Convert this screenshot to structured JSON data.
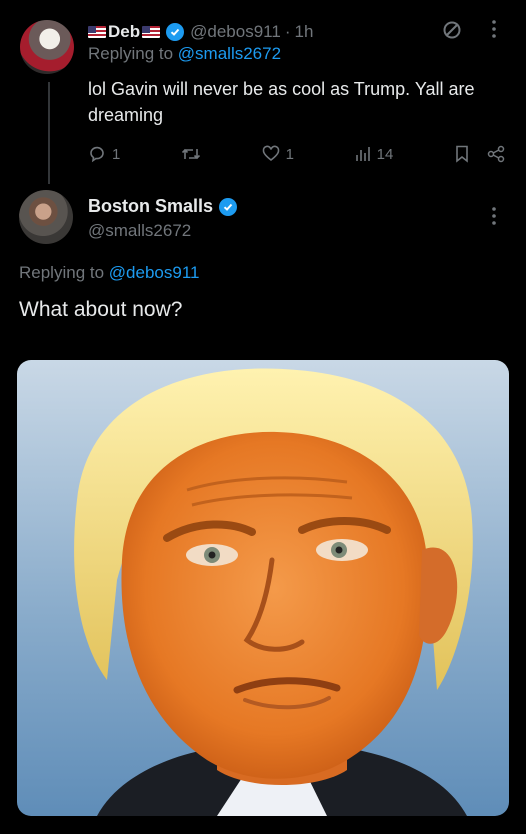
{
  "parent_tweet": {
    "display_name": "Deb",
    "handle": "@debos911",
    "time": "1h",
    "replying_prefix": "Replying to",
    "replying_to": "@smalls2672",
    "text": "lol Gavin will never be as cool as Trump. Yall are dreaming",
    "replies": "1",
    "likes": "1",
    "views": "14"
  },
  "main_tweet": {
    "display_name": "Boston Smalls",
    "handle": "@smalls2672",
    "replying_prefix": "Replying to",
    "replying_to": "@debos911",
    "text": "What about now?",
    "image_alt": "Edited portrait with orange skin tone and blond hair"
  },
  "colors": {
    "background": "#000000",
    "text": "#e7e9ea",
    "muted": "#71767b",
    "accent": "#1d9bf0"
  },
  "icons": [
    "avatar",
    "flag-icon",
    "verified-badge-icon",
    "grok-icon",
    "more-icon",
    "reply-icon",
    "retweet-icon",
    "like-icon",
    "views-icon",
    "bookmark-icon",
    "share-icon"
  ]
}
